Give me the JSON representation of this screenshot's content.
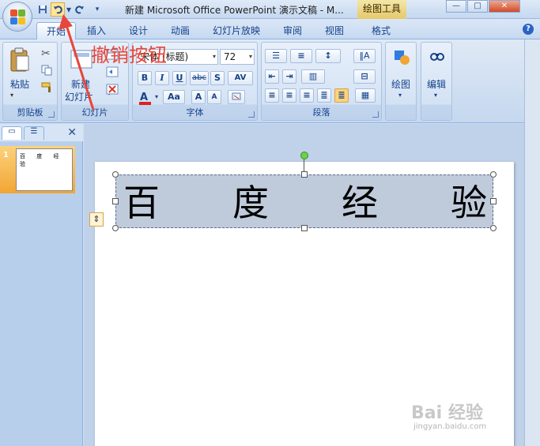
{
  "window": {
    "title": "新建 Microsoft Office PowerPoint 演示文稿 - M...",
    "context_tab": "绘图工具"
  },
  "ribbon_tabs": [
    {
      "label": "开始",
      "active": true
    },
    {
      "label": "插入"
    },
    {
      "label": "设计"
    },
    {
      "label": "动画"
    },
    {
      "label": "幻灯片放映"
    },
    {
      "label": "审阅"
    },
    {
      "label": "视图"
    },
    {
      "label": "格式"
    }
  ],
  "groups": {
    "clipboard": {
      "label": "剪贴板",
      "paste": "粘贴"
    },
    "slides": {
      "label": "幻灯片",
      "new_slide_line1": "新建",
      "new_slide_line2": "幻灯片"
    },
    "font": {
      "label": "字体",
      "font_name": "宋体 (标题)",
      "font_size": "72",
      "bold": "B",
      "italic": "I",
      "underline": "U",
      "strike": "abc",
      "shadow": "S",
      "spacing": "AV",
      "grow": "A",
      "shrink": "A",
      "case": "Aa"
    },
    "paragraph": {
      "label": "段落"
    },
    "drawing": {
      "label": "绘图"
    },
    "editing": {
      "label": "编辑"
    }
  },
  "slide": {
    "chars": [
      "百",
      "度",
      "经",
      "验"
    ]
  },
  "thumbnail": {
    "number": "1",
    "text": "百 度 经 验"
  },
  "annotation": "撤销按钮",
  "watermark": {
    "brand": "Bai 经验",
    "url": "jingyan.baidu.com"
  },
  "colors": {
    "annotation": "#e8463a",
    "accent": "#15428b"
  }
}
